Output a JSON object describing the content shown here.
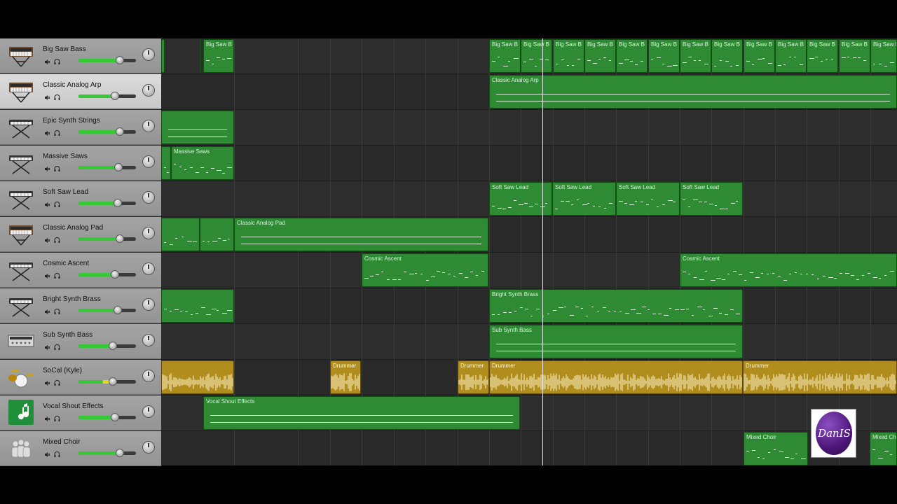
{
  "colors": {
    "midi_region": "#2e8b34",
    "audio_region": "#b08d1c",
    "volume_fill": "#37c837"
  },
  "playhead_time": null,
  "tracks": [
    {
      "name": "Big Saw Bass",
      "icon": "synth-keyboard-icon",
      "volume": 0.72
    },
    {
      "name": "Classic Analog Arp",
      "icon": "synth-keyboard-icon",
      "volume": 0.64,
      "selected": true
    },
    {
      "name": "Epic Synth Strings",
      "icon": "keyboard-stand-icon",
      "volume": 0.72
    },
    {
      "name": "Massive Saws",
      "icon": "keyboard-stand-icon",
      "volume": 0.7
    },
    {
      "name": "Soft Saw Lead",
      "icon": "keyboard-stand-icon",
      "volume": 0.68
    },
    {
      "name": "Classic Analog Pad",
      "icon": "synth-keyboard-icon",
      "volume": 0.72
    },
    {
      "name": "Cosmic Ascent",
      "icon": "keyboard-stand-icon",
      "volume": 0.64
    },
    {
      "name": "Bright Synth Brass",
      "icon": "keyboard-stand-icon",
      "volume": 0.68
    },
    {
      "name": "Sub Synth Bass",
      "icon": "rack-synth-icon",
      "volume": 0.6
    },
    {
      "name": "SoCal (Kyle)",
      "icon": "drum-kit-icon",
      "volume": 0.6
    },
    {
      "name": "Vocal Shout Effects",
      "icon": "music-note-icon",
      "volume": 0.64
    },
    {
      "name": "Mixed Choir",
      "icon": "choir-icon",
      "volume": 0.72
    }
  ],
  "regions": [
    {
      "track": 0,
      "label": "B"
    },
    {
      "track": 0,
      "label": "Big Saw B"
    },
    {
      "track": 0,
      "label": "Big Saw B"
    },
    {
      "track": 0,
      "label": "Big Saw B"
    },
    {
      "track": 0,
      "label": "Big Saw B"
    },
    {
      "track": 0,
      "label": "Big Saw B"
    },
    {
      "track": 0,
      "label": "Big Saw B"
    },
    {
      "track": 0,
      "label": "Big Saw B"
    },
    {
      "track": 0,
      "label": "Big Saw B"
    },
    {
      "track": 0,
      "label": "Big Saw B"
    },
    {
      "track": 0,
      "label": "Big Saw B"
    },
    {
      "track": 0,
      "label": "Big Saw B"
    },
    {
      "track": 0,
      "label": "Big Saw B"
    },
    {
      "track": 0,
      "label": "Big Saw B"
    },
    {
      "track": 0,
      "label": "Big Saw B"
    },
    {
      "track": 0,
      "label": "Big Saw B"
    },
    {
      "track": 1,
      "label": "Classic Analog Arp"
    },
    {
      "track": 2,
      "label": ""
    },
    {
      "track": 3,
      "label": ""
    },
    {
      "track": 3,
      "label": "Massive Saws"
    },
    {
      "track": 4,
      "label": "Soft Saw Lead"
    },
    {
      "track": 4,
      "label": "Soft Saw Lead"
    },
    {
      "track": 4,
      "label": "Soft Saw Lead"
    },
    {
      "track": 4,
      "label": "Soft Saw Lead"
    },
    {
      "track": 5,
      "label": ""
    },
    {
      "track": 5,
      "label": ""
    },
    {
      "track": 5,
      "label": "Classic Analog Pad"
    },
    {
      "track": 6,
      "label": "Cosmic Ascent"
    },
    {
      "track": 6,
      "label": "Cosmic Ascent"
    },
    {
      "track": 7,
      "label": ""
    },
    {
      "track": 7,
      "label": "Bright Synth Brass"
    },
    {
      "track": 8,
      "label": "Sub Synth Bass"
    },
    {
      "track": 9,
      "label": ""
    },
    {
      "track": 9,
      "label": "Drummer"
    },
    {
      "track": 9,
      "label": "Drummer"
    },
    {
      "track": 9,
      "label": "Drummer"
    },
    {
      "track": 9,
      "label": "Drummer"
    },
    {
      "track": 10,
      "label": "Vocal Shout Effects"
    },
    {
      "track": 11,
      "label": "Mixed Choir"
    },
    {
      "track": 11,
      "label": "Mixed Ch"
    }
  ],
  "logo": {
    "text": "DanIS"
  }
}
